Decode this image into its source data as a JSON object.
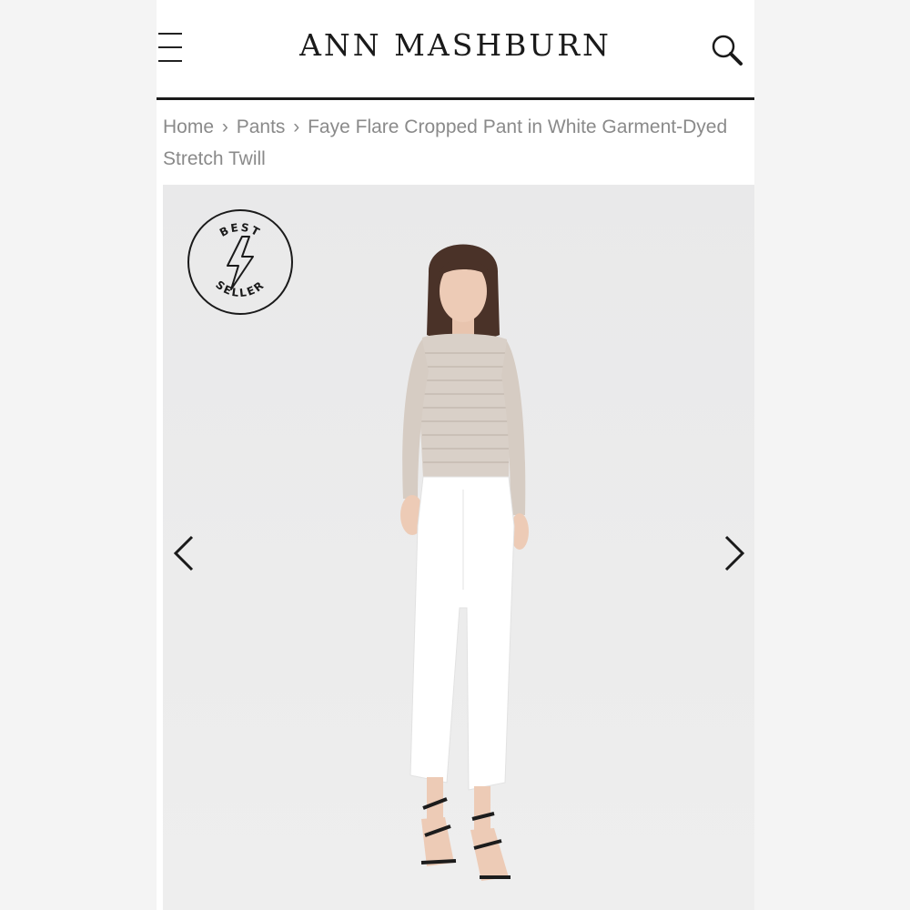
{
  "header": {
    "brand": "ANN MASHBURN",
    "menu_icon": "hamburger-menu-icon",
    "search_icon": "search-icon"
  },
  "breadcrumb": {
    "items": [
      "Home",
      "Pants",
      "Faye Flare Cropped Pant in White Garment-Dyed Stretch Twill"
    ],
    "separator": "›"
  },
  "gallery": {
    "badge": {
      "top": "BEST",
      "bottom": "SELLER",
      "icon": "lightning-bolt-icon"
    },
    "prev_icon": "chevron-left-icon",
    "next_icon": "chevron-right-icon"
  },
  "colors": {
    "text_dark": "#1a1a1a",
    "breadcrumb_gray": "#8a8a8a",
    "gallery_bg": "#ebebeb"
  }
}
